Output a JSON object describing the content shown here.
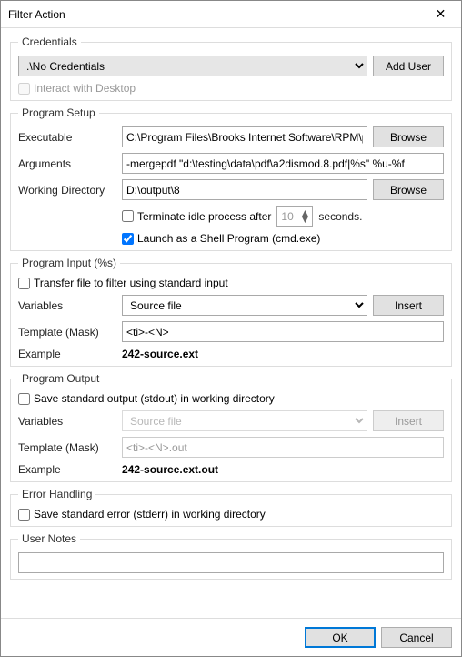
{
  "window": {
    "title": "Filter Action"
  },
  "credentials": {
    "legend": "Credentials",
    "selected": ".\\No Credentials",
    "addUser": "Add User",
    "interact": "Interact with Desktop"
  },
  "setup": {
    "legend": "Program Setup",
    "executableLabel": "Executable",
    "executableValue": "C:\\Program Files\\Brooks Internet Software\\RPM\\pcl",
    "browse": "Browse",
    "argumentsLabel": "Arguments",
    "argumentsValue": "-mergepdf \"d:\\testing\\data\\pdf\\a2dismod.8.pdf|%s\" %u-%f",
    "workingDirLabel": "Working Directory",
    "workingDirValue": "D:\\output\\8",
    "terminateLabel": "Terminate idle process after",
    "terminateSeconds": "10",
    "secondsLabel": "seconds.",
    "launchShell": "Launch as a Shell Program (cmd.exe)"
  },
  "input": {
    "legend": "Program Input (%s)",
    "transfer": "Transfer file to filter using standard input",
    "variablesLabel": "Variables",
    "variableSelected": "Source file",
    "insert": "Insert",
    "templateLabel": "Template (Mask)",
    "templateValue": "<ti>-<N>",
    "exampleLabel": "Example",
    "exampleValue": "242-source.ext"
  },
  "output": {
    "legend": "Program Output",
    "saveStdout": "Save standard output (stdout) in working directory",
    "variablesLabel": "Variables",
    "variableSelected": "Source file",
    "insert": "Insert",
    "templateLabel": "Template (Mask)",
    "templateValue": "<ti>-<N>.out",
    "exampleLabel": "Example",
    "exampleValue": "242-source.ext.out"
  },
  "error": {
    "legend": "Error Handling",
    "saveStderr": "Save standard error (stderr) in working directory"
  },
  "notes": {
    "legend": "User Notes",
    "value": ""
  },
  "footer": {
    "ok": "OK",
    "cancel": "Cancel"
  }
}
